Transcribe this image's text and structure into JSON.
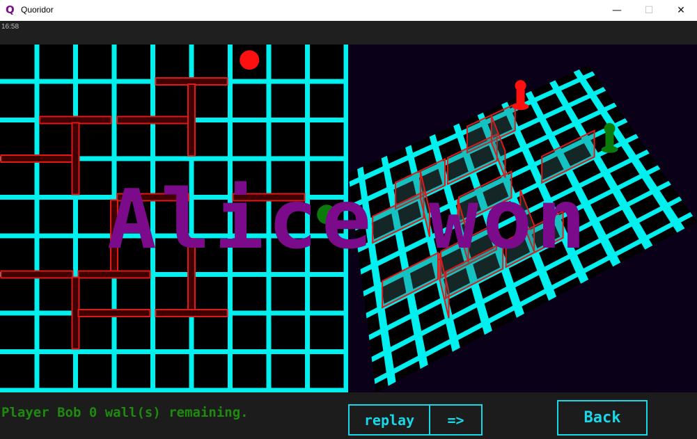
{
  "window": {
    "title": "Quoridor",
    "app_icon": "Q",
    "minimize": "—",
    "maximize": "☐",
    "close": "✕"
  },
  "clock": "16:58",
  "banner": "Alice won",
  "status": "Player Bob 0 wall(s) remaining.",
  "controls": {
    "replay": "replay",
    "next": "=>",
    "back": "Back"
  },
  "colors": {
    "grid": "#00f0f0",
    "wall": "#e01818",
    "player_red": "#ff1010",
    "player_green": "#0b7a0b",
    "banner": "#7b0b8a",
    "button": "#17d7e8",
    "status": "#1e8a0e"
  },
  "board": {
    "size": 9,
    "players": [
      {
        "name": "red",
        "col": 6,
        "row": 0
      },
      {
        "name": "green",
        "col": 8,
        "row": 4
      }
    ],
    "walls": [
      {
        "o": "h",
        "c": 4,
        "r": 0
      },
      {
        "o": "h",
        "c": 1,
        "r": 1
      },
      {
        "o": "h",
        "c": 3,
        "r": 1
      },
      {
        "o": "v",
        "c": 4,
        "r": 1
      },
      {
        "o": "h",
        "c": 0,
        "r": 2
      },
      {
        "o": "v",
        "c": 1,
        "r": 2
      },
      {
        "o": "h",
        "c": 3,
        "r": 3
      },
      {
        "o": "v",
        "c": 2,
        "r": 4
      },
      {
        "o": "h",
        "c": 0,
        "r": 5
      },
      {
        "o": "h",
        "c": 2,
        "r": 5
      },
      {
        "o": "v",
        "c": 4,
        "r": 5
      },
      {
        "o": "v",
        "c": 1,
        "r": 6
      },
      {
        "o": "h",
        "c": 2,
        "r": 6
      },
      {
        "o": "h",
        "c": 4,
        "r": 6
      },
      {
        "o": "h",
        "c": 6,
        "r": 3
      }
    ]
  }
}
